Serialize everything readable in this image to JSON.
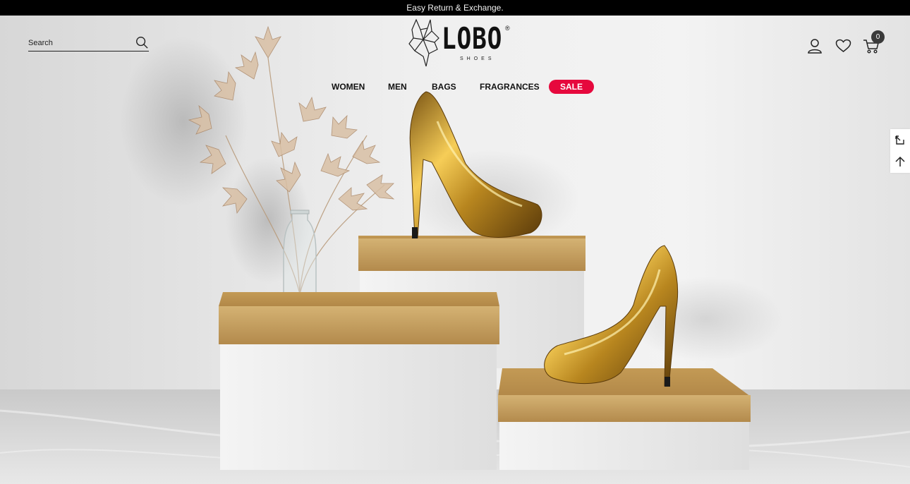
{
  "announcement": {
    "text": "Easy Return & Exchange."
  },
  "search": {
    "placeholder": "Search"
  },
  "logo": {
    "word": "LOBO",
    "sub": "SHOES",
    "reg": "®"
  },
  "nav": {
    "items": [
      {
        "label": "WOMEN"
      },
      {
        "label": "MEN"
      },
      {
        "label": "BAGS"
      },
      {
        "label": "FRAGRANCES"
      }
    ],
    "sale": {
      "label": "SALE",
      "color": "#e6083d"
    }
  },
  "header_icons": {
    "account": "user-icon",
    "wishlist": "heart-icon",
    "cart": "cart-icon",
    "cart_count": "0"
  },
  "side_tools": {
    "expand": "expand-icon",
    "back_to_top": "arrow-up-icon"
  },
  "colors": {
    "gold": "#c9a25e",
    "sale_red": "#e6083d",
    "announcement_bg": "#000000"
  }
}
